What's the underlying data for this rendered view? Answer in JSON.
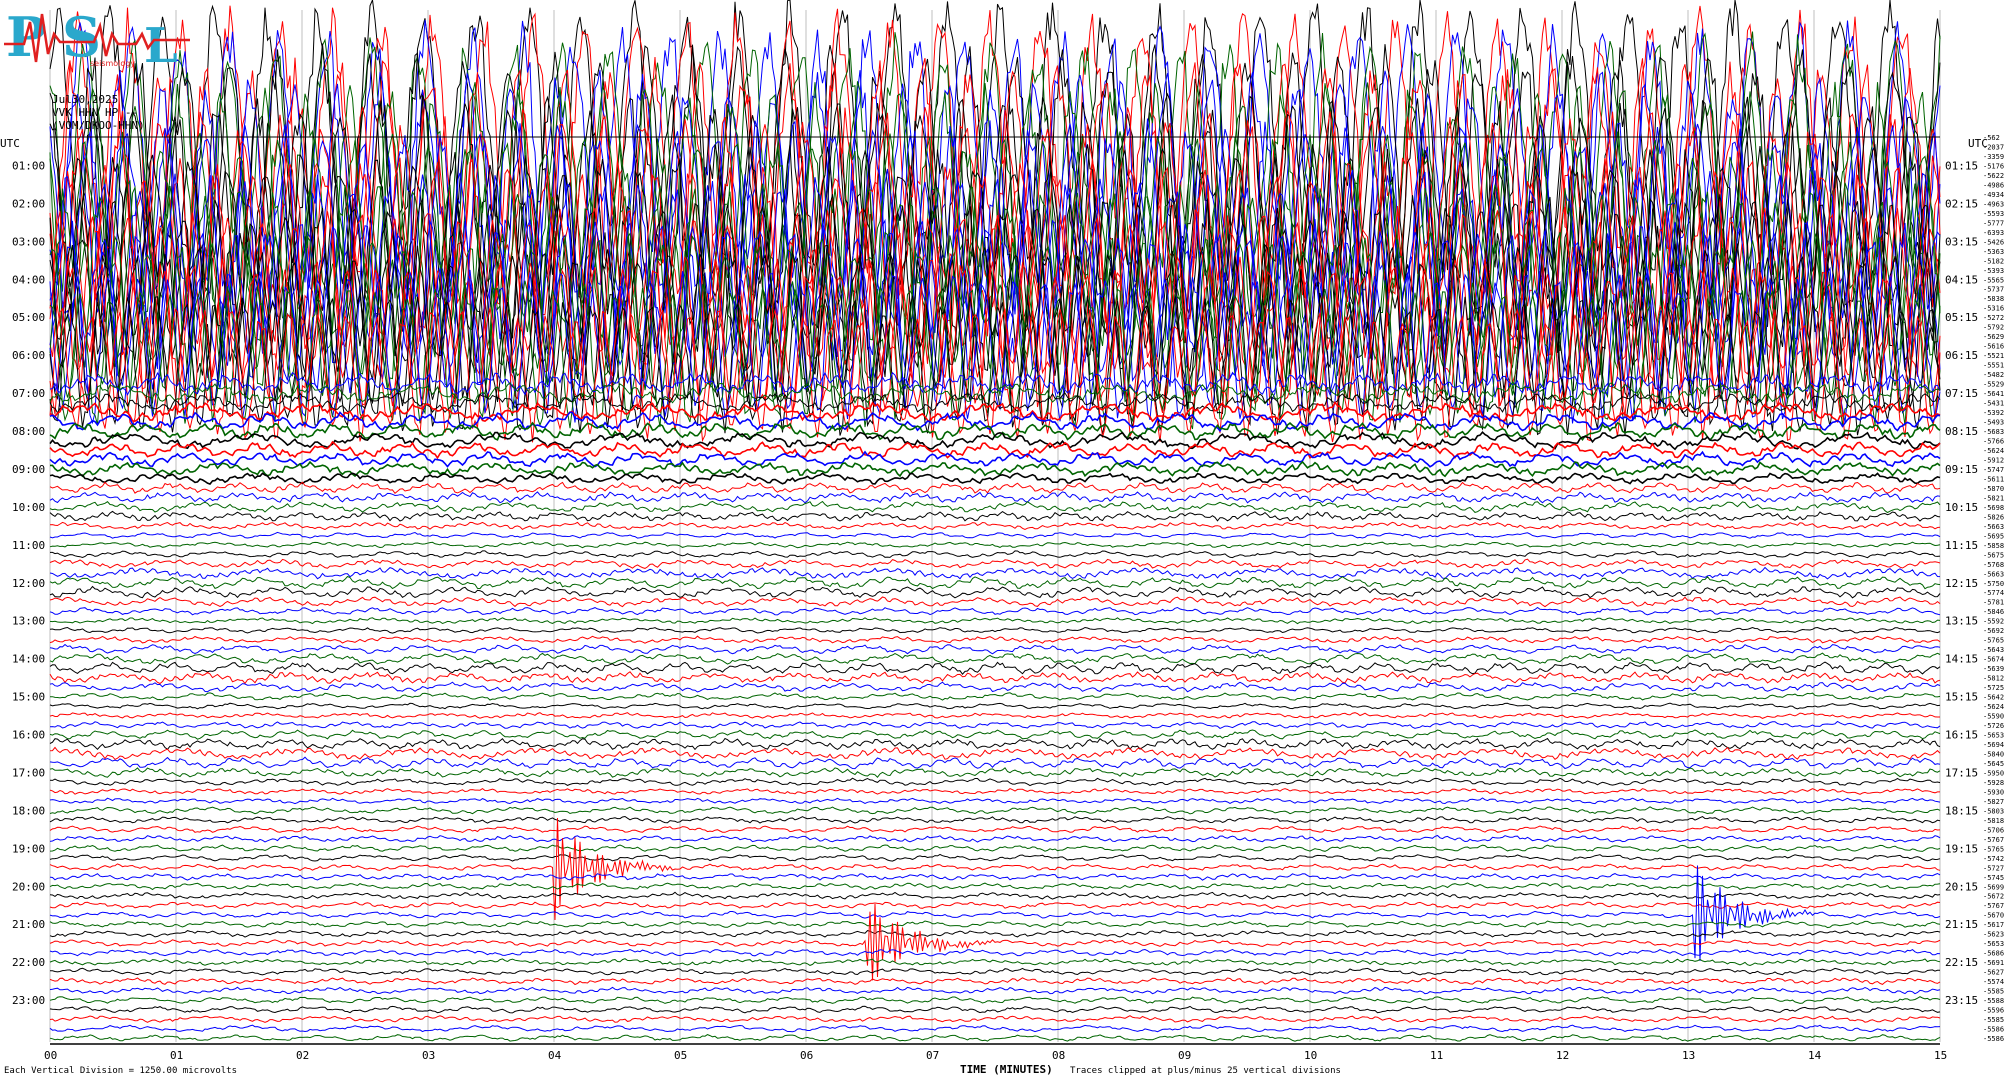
{
  "logo": {
    "text": "PSN",
    "subtext": "seismology"
  },
  "header": {
    "date": "Jul30,2025",
    "station": "VVK HHN HP --",
    "source": "(VOM/DKOO-HHN)",
    "utc_left": "UTC",
    "utc_right": "UTC"
  },
  "footer": {
    "vertical_division": "Each Vertical Division = 1250.00 microvolts",
    "xlabel": "TIME (MINUTES)",
    "clip_note": "Traces clipped at plus/minus 25 vertical divisions"
  },
  "colors": {
    "trace_cycle": [
      "#000000",
      "#ff0000",
      "#0000ff",
      "#006400"
    ],
    "grid": "#bfbfbf"
  },
  "chart_data": {
    "type": "line",
    "title": "",
    "xlabel": "TIME (MINUTES)",
    "ylabel": "UTC",
    "xlim": [
      0,
      15
    ],
    "x_ticks": [
      "00",
      "01",
      "02",
      "03",
      "04",
      "05",
      "06",
      "07",
      "08",
      "09",
      "10",
      "11",
      "12",
      "13",
      "14",
      "15"
    ],
    "left_hour_labels": [
      "01:00",
      "02:00",
      "03:00",
      "04:00",
      "05:00",
      "06:00",
      "07:00",
      "08:00",
      "09:00",
      "10:00",
      "11:00",
      "12:00",
      "13:00",
      "14:00",
      "15:00",
      "16:00",
      "17:00",
      "18:00",
      "19:00",
      "20:00",
      "21:00",
      "22:00",
      "23:00"
    ],
    "right_hour_labels": [
      "01:15",
      "02:15",
      "03:15",
      "04:15",
      "05:15",
      "06:15",
      "07:15",
      "08:15",
      "09:15",
      "10:15",
      "11:15",
      "12:15",
      "13:15",
      "14:15",
      "15:15",
      "16:15",
      "17:15",
      "18:15",
      "19:15",
      "20:15",
      "21:15",
      "22:15",
      "23:15"
    ],
    "trace_count": 96,
    "right_offsets": [
      "-562",
      "-2037",
      "-3359",
      "-5176",
      "-5622",
      "-4986",
      "-4934",
      "-4963",
      "-5593",
      "-5777",
      "-6393",
      "-5426",
      "-5363",
      "-5182",
      "-5393",
      "-5565",
      "-5737",
      "-5838",
      "-5316",
      "-5272",
      "-5792",
      "-5629",
      "-5616",
      "-5521",
      "-5551",
      "-5482",
      "-5529",
      "-5641",
      "-5431",
      "-5392",
      "-5493",
      "-5683",
      "-5766",
      "-5624",
      "-5912",
      "-5747",
      "-5611",
      "-5870",
      "-5821",
      "-5698",
      "-5826",
      "-5663",
      "-5695",
      "-5858",
      "-5675",
      "-5768",
      "-5663",
      "-5750",
      "-5774",
      "-5781",
      "-5846",
      "-5592",
      "-5692",
      "-5765",
      "-5643",
      "-5674",
      "-5639",
      "-5812",
      "-5725",
      "-5642",
      "-5624",
      "-5590",
      "-5726",
      "-5653",
      "-5694",
      "-5840",
      "-5645",
      "-5950",
      "-5928",
      "-5930",
      "-5827",
      "-5803",
      "-5818",
      "-5706",
      "-5767",
      "-5765",
      "-5742",
      "-5727",
      "-5745",
      "-5699",
      "-5672",
      "-5767",
      "-5670",
      "-5617",
      "-5623",
      "-5653",
      "-5686",
      "-5691",
      "-5627",
      "-5574",
      "-5585",
      "-5588",
      "-5596",
      "-5585",
      "-5586",
      "-5586"
    ],
    "events": [
      {
        "label": "",
        "trace_hour": "20:00",
        "minute": 4.0
      },
      {
        "label": "",
        "trace_hour": "22:00",
        "minute": 6.45
      },
      {
        "label": "",
        "trace_hour": "21:15",
        "minute": 13.05
      }
    ],
    "grid": true,
    "legend": "none"
  }
}
